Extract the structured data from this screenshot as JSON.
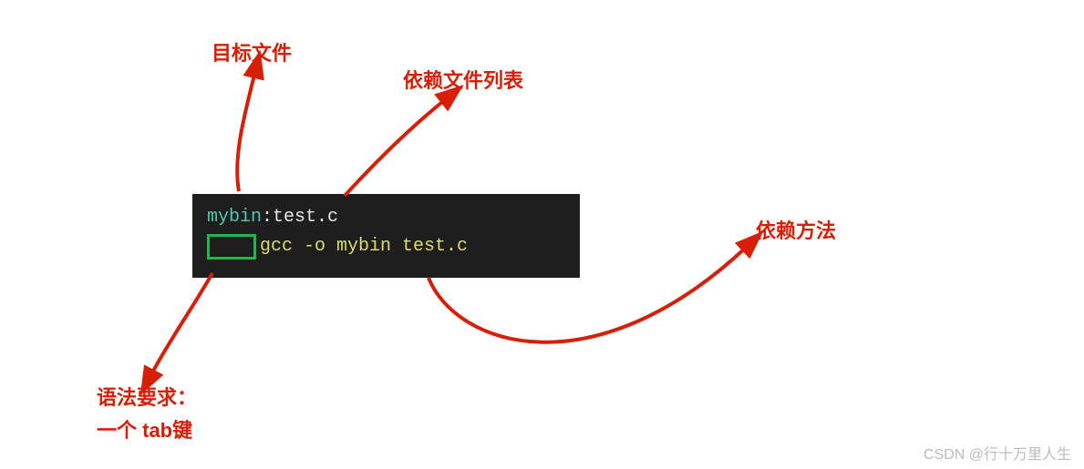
{
  "labels": {
    "target_file": "目标文件",
    "dependency_list": "依赖文件列表",
    "dependency_method": "依赖方法",
    "syntax_req_line1": "语法要求：",
    "syntax_req_line2": "一个 tab键"
  },
  "code": {
    "target": "mybin",
    "colon": ":",
    "deps": "test.c",
    "command": "gcc -o mybin test.c"
  },
  "watermark": "CSDN @行十万里人生",
  "colors": {
    "annotation_red": "#d81e06",
    "code_bg": "#1e1e1e",
    "tab_border_green": "#1fb84d",
    "cyan_token": "#4ec9b0",
    "white_token": "#e6e6e6",
    "yellow_token": "#dcdc6f"
  }
}
